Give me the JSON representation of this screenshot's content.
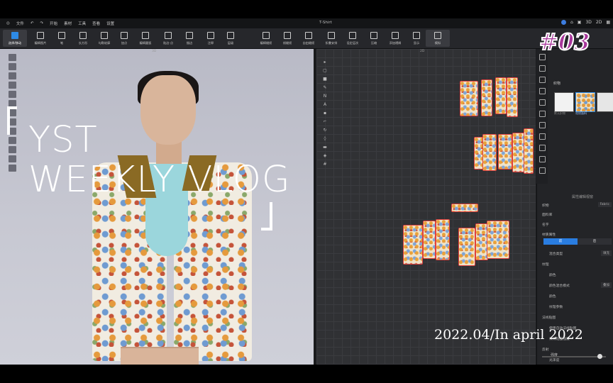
{
  "menubar": {
    "items": [
      "文件",
      "开始",
      "素材",
      "工具",
      "查看",
      "设置"
    ],
    "title": "T-Shirt"
  },
  "toolbar": {
    "tools": [
      "选择/移动",
      "编辑图片",
      "笔",
      "长方形",
      "勾勒轮廓",
      "加点",
      "编辑圆弧",
      "贴边-点",
      "描边",
      "注释",
      "层级",
      "编辑缝纫",
      "线缝纫",
      "自由缝纫",
      "折叠安排",
      "设定层次",
      "压缩",
      "添加褶裥",
      "显示",
      "模拟"
    ]
  },
  "viewports": {
    "left_label": "3D",
    "right_label": "2D"
  },
  "overlay": {
    "title_line1": "YST",
    "title_line2": "WEEKLY VLOG",
    "open_bracket": "「",
    "close_bracket": "」",
    "episode": "#03",
    "date": "2022.04/In april 2022"
  },
  "right_panel": {
    "header": "织物",
    "swatch_labels": [
      "默认织物",
      "花纹面料"
    ],
    "props_header": "属性编辑视窗",
    "rows": [
      {
        "label": "织物",
        "value": "Fabric"
      },
      {
        "label": "面料库",
        "value": ""
      },
      {
        "label": "名字",
        "value": ""
      },
      {
        "label": "材质属性",
        "value": ""
      }
    ],
    "tabs": [
      "前",
      "后"
    ],
    "sub_rows": [
      "混合类型",
      "纹理",
      "颜色",
      "颜色混合模式",
      "颜色",
      "纹理参数",
      "法线贴图",
      "使用自动法线贴图",
      "法线贴图强度",
      "反射",
      "光泽度",
      "强度"
    ],
    "blend_value": "填充",
    "mix_value": "叠加"
  },
  "colors": {
    "accent": "#2e8be6",
    "episode": "#a8379b",
    "pattern_outline": "#e0403e"
  }
}
